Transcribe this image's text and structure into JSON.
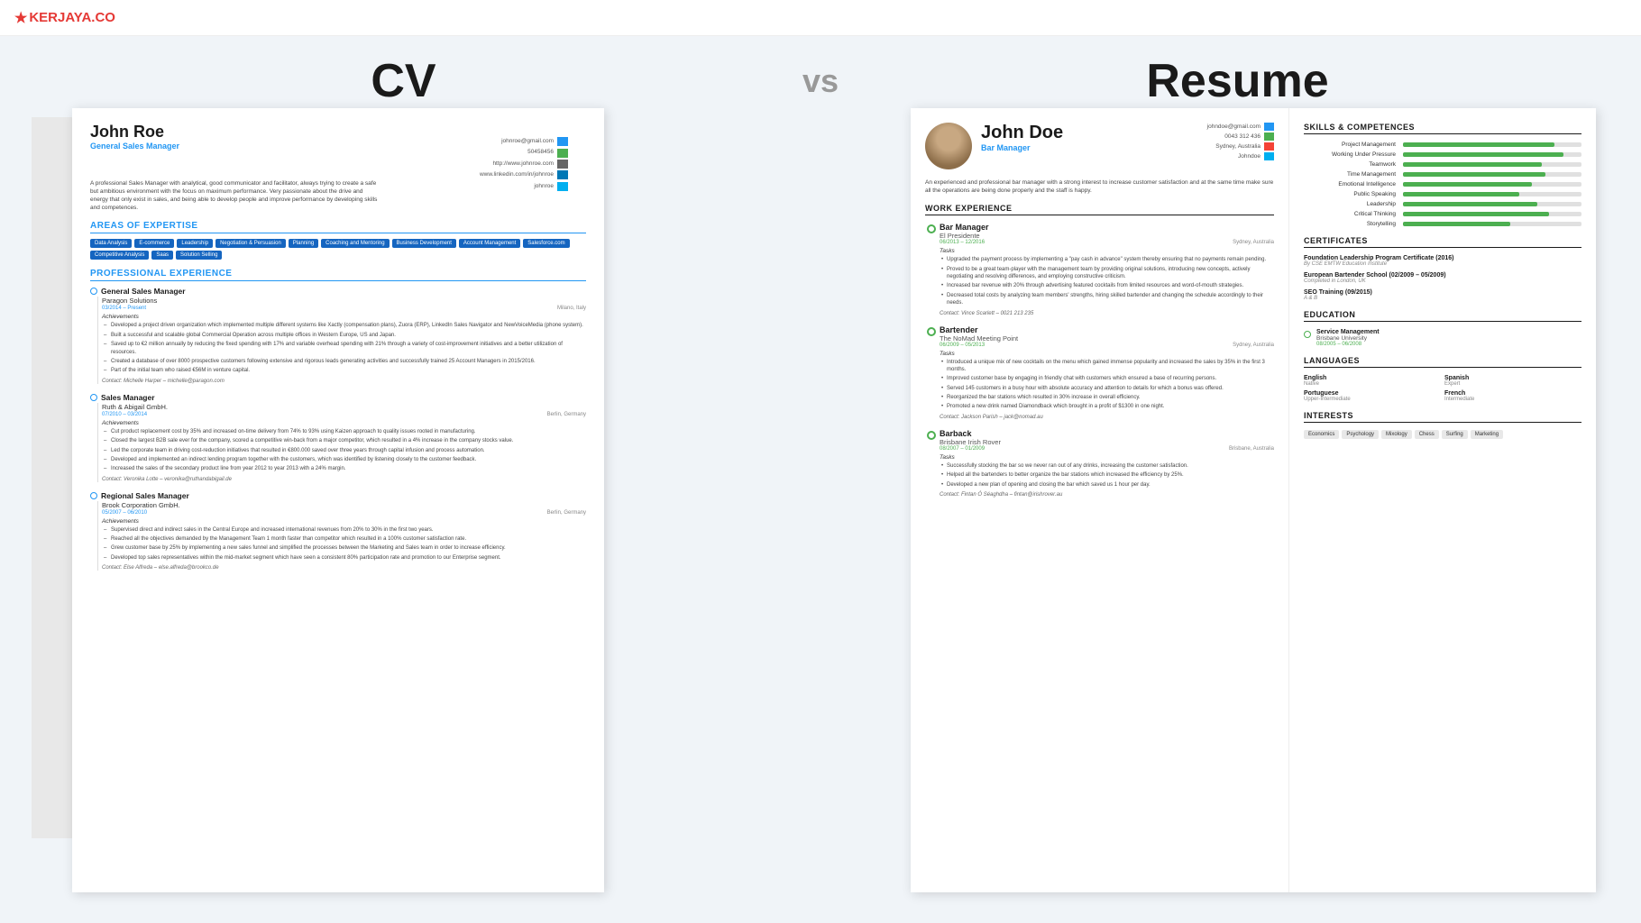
{
  "header": {
    "logo": "KERJAYA.CO"
  },
  "titles": {
    "cv": "CV",
    "vs": "vs",
    "resume": "Resume"
  },
  "cv": {
    "name": "John Roe",
    "title": "General Sales Manager",
    "contact": {
      "email": "johnroe@gmail.com",
      "phone": "50458456",
      "website": "http://www.johnroe.com",
      "linkedin": "www.linkedin.com/in/johnroe",
      "skype": "johnroe"
    },
    "description": "A professional Sales Manager with analytical, good communicator and facilitator, always trying to create a safe but ambitious environment with the focus on maximum performance. Very passionate about the drive and energy that only exist in sales, and being able to develop people and improve performance by developing skills and competences.",
    "areas": {
      "title": "AREAS OF EXPERTISE",
      "tags": [
        "Data Analysis",
        "E-commerce",
        "Leadership",
        "Negotiation & Persuasion",
        "Planning",
        "Coaching and Mentoring",
        "Business Development",
        "Account Management",
        "Salesforce.com",
        "Competitive Analysis",
        "Saas",
        "Solution Selling"
      ]
    },
    "experience": {
      "title": "PROFESSIONAL EXPERIENCE",
      "jobs": [
        {
          "title": "General Sales Manager",
          "company": "Paragon Solutions",
          "date": "03/2014 – Present",
          "location": "Milano, Italy",
          "achievements": [
            "Developed a project driven organization which implemented multiple different systems like Xactly (compensation plans), Zuora (ERP), LinkedIn Sales Navigator and NewVoiceMedia (phone system).",
            "Built a successful and scalable global Commercial Operation across multiple offices in Western Europe, US and Japan.",
            "Saved up to €2 million annually by reducing the fixed spending with 17% and variable overhead spending with 21% through a variety of cost-improvement initiatives and a better utilization of resources.",
            "Created a database of over 8000 prospective customers following extensive and rigorous leads generating activities and successfully trained 25 Account Managers in 2015/2016.",
            "Part of the initial team who raised €56M in venture capital."
          ],
          "contact": "Michelle Harper – michelle@paragon.com"
        },
        {
          "title": "Sales Manager",
          "company": "Ruth & Abigail GmbH.",
          "date": "07/2010 – 03/2014",
          "location": "Berlin, Germany",
          "achievements": [
            "Cut product replacement cost by 35% and increased on-time delivery from 74% to 93% using Kaizen approach to quality issues rooted in manufacturing.",
            "Closed the largest B2B sale ever for the company, scored a competitive win-back from a major competitor, which resulted in a 4% increase in the company stocks value.",
            "Led the corporate team in driving cost-reduction initiatives that resulted in €800.000 saved over three years through capital infusion and process automation.",
            "Developed and implemented an indirect lending program together with the customers, which was identified by listening closely to the customer feedback.",
            "Increased the sales of the secondary product line from year 2012 to year 2013 with a 24% margin."
          ],
          "contact": "Veronika Lotte – veronika@ruthandabigail.de"
        },
        {
          "title": "Regional Sales Manager",
          "company": "Brook Corporation GmbH.",
          "date": "05/2007 – 06/2010",
          "location": "Berlin, Germany",
          "achievements": [
            "Supervised direct and indirect sales in the Central Europe and increased international revenues from 20% to 30% in the first two years.",
            "Reached all the objectives demanded by the Management Team 1 month faster than competitor which resulted in a 100% customer satisfaction rate.",
            "Grew customer base by 25% by implementing a new sales funnel and simplified the processes between the Marketing and Sales team in order to increase efficiency.",
            "Developed top sales representatives within the mid-market segment which have seen a consistent 80% participation rate and promotion to our Enterprise segment."
          ],
          "contact": "Else Alfreda – else.alfreda@brookco.de"
        }
      ]
    }
  },
  "resume": {
    "name": "John Doe",
    "title": "Bar Manager",
    "contact": {
      "email": "johndoe@gmail.com",
      "phone": "0043 312 436",
      "location": "Sydney, Australia",
      "skype": "Johndoe"
    },
    "description": "An experienced and professional bar manager with a strong interest to increase customer satisfaction and at the same time make sure all the operations are being done properly and the staff is happy.",
    "work_experience": {
      "title": "WORK EXPERIENCE",
      "jobs": [
        {
          "title": "Bar Manager",
          "company": "El Presidente",
          "date": "06/2013 – 12/2016",
          "location": "Sydney, Australia",
          "tasks": [
            "Upgraded the payment process by implementing a 'pay cash in advance' system thereby ensuring that no payments remain pending.",
            "Proved to be a great team-player with the management team by providing original solutions, introducing new concepts, actively negotiating and resolving differences, and employing constructive criticism.",
            "Increased bar revenue with 20% through advertising featured cocktails from limited resources and word-of-mouth strategies.",
            "Decreased total costs by analyzing team members' strengths, hiring skilled bartender and changing the schedule accordingly to their needs."
          ],
          "contact": "Vince Scarlett – 0021 213 235"
        },
        {
          "title": "Bartender",
          "company": "The NoMad Meeting Point",
          "date": "06/2009 – 05/2013",
          "location": "Sydney, Australia",
          "tasks": [
            "Introduced a unique mix of new cocktails on the menu which gained immense popularity and increased the sales by 35% in the first 3 months.",
            "Improved customer base by engaging in friendly chat with customers which ensured a base of recurring persons.",
            "Served 145 customers in a busy hour with absolute accuracy and attention to details for which a bonus was offered.",
            "Reorganized the bar stations which resulted in 30% increase in overall efficiency.",
            "Promoted a new drink named Diamondback which brought in a profit of $1300 in one night."
          ],
          "contact": "Jackson Parish – jack@nomad.au"
        },
        {
          "title": "Barback",
          "company": "Brisbane Irish Rover",
          "date": "08/2007 – 01/2009",
          "location": "Brisbane, Australia",
          "tasks": [
            "Successfully stocking the bar so we never ran out of any drinks, increasing the customer satisfaction.",
            "Helped all the bartenders to better organize the bar stations which increased the efficiency by 25%.",
            "Developed a new plan of opening and closing the bar which saved us 1 hour per day."
          ],
          "contact": "Fintan Ó Séaghdha – fintan@irishrover.au"
        }
      ]
    },
    "skills": {
      "title": "SKILLS & COMPETENCES",
      "items": [
        {
          "name": "Project Management",
          "pct": 85
        },
        {
          "name": "Working Under Pressure",
          "pct": 90
        },
        {
          "name": "Teamwork",
          "pct": 78
        },
        {
          "name": "Time Management",
          "pct": 80
        },
        {
          "name": "Emotional Intelligence",
          "pct": 72
        },
        {
          "name": "Public Speaking",
          "pct": 65
        },
        {
          "name": "Leadership",
          "pct": 75
        },
        {
          "name": "Critical Thinking",
          "pct": 82
        },
        {
          "name": "Storytelling",
          "pct": 60
        }
      ]
    },
    "certificates": {
      "title": "CERTIFICATES",
      "items": [
        {
          "name": "Foundation Leadership Program Certificate (2016)",
          "org": "By CSE EMTW Education Institute"
        },
        {
          "name": "European Bartender School (02/2009 – 05/2009)",
          "org": "Completed in London, UK"
        },
        {
          "name": "SEO Training (09/2015)",
          "org": "A & B"
        }
      ]
    },
    "education": {
      "title": "EDUCATION",
      "items": [
        {
          "degree": "Service Management",
          "school": "Brisbane University",
          "date": "08/2005 – 06/2008"
        }
      ]
    },
    "languages": {
      "title": "LANGUAGES",
      "items": [
        {
          "name": "English",
          "level": "Native"
        },
        {
          "name": "Spanish",
          "level": "Expert"
        },
        {
          "name": "Portuguese",
          "level": "Upper-Intermediate"
        },
        {
          "name": "French",
          "level": "Intermediate"
        }
      ]
    },
    "interests": {
      "title": "INTERESTS",
      "tags": [
        "Economics",
        "Psychology",
        "Mixology",
        "Chess",
        "Surfing",
        "Marketing"
      ]
    }
  }
}
